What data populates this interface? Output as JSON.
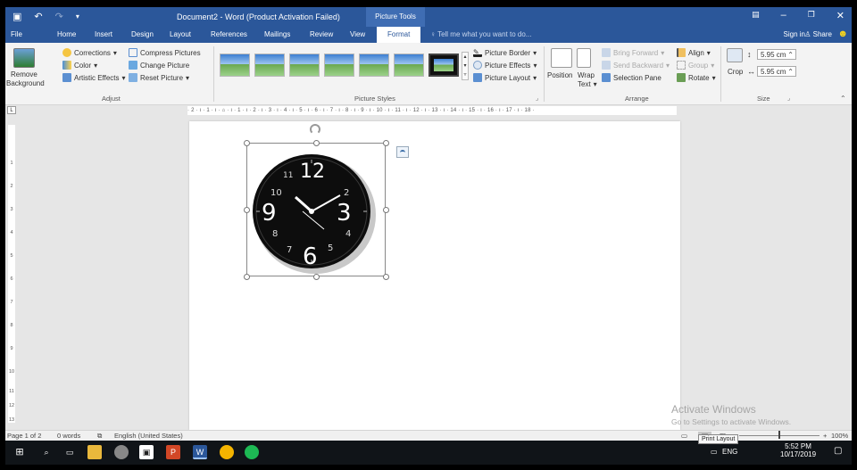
{
  "titlebar": {
    "title": "Document2 - Word (Product Activation Failed)",
    "tools_tab": "Picture Tools",
    "qat_save_icon": "save-icon",
    "qat_undo_icon": "undo-icon",
    "qat_redo_icon": "redo-icon",
    "qat_more_icon": "customize-qat-icon"
  },
  "tabs": [
    {
      "label": "File"
    },
    {
      "label": "Home"
    },
    {
      "label": "Insert"
    },
    {
      "label": "Design"
    },
    {
      "label": "Layout"
    },
    {
      "label": "References"
    },
    {
      "label": "Mailings"
    },
    {
      "label": "Review"
    },
    {
      "label": "View"
    },
    {
      "label": "Format",
      "active": true
    }
  ],
  "tell_me": "Tell me what you want to do...",
  "account": {
    "sign_in": "Sign in",
    "share": "Share"
  },
  "ribbon": {
    "adjust": {
      "label": "Adjust",
      "remove_background_1": "Remove",
      "remove_background_2": "Background",
      "corrections": "Corrections",
      "color": "Color",
      "artistic_effects": "Artistic Effects",
      "compress": "Compress Pictures",
      "change": "Change Picture",
      "reset": "Reset Picture"
    },
    "picture_styles": {
      "label": "Picture Styles",
      "border": "Picture Border",
      "effects": "Picture Effects",
      "layout": "Picture Layout"
    },
    "arrange": {
      "label": "Arrange",
      "position": "Position",
      "wrap_1": "Wrap",
      "wrap_2": "Text",
      "bring_forward": "Bring Forward",
      "send_backward": "Send Backward",
      "selection_pane": "Selection Pane",
      "align": "Align",
      "group": "Group",
      "rotate": "Rotate"
    },
    "size": {
      "label": "Size",
      "crop": "Crop",
      "height": "5.95 cm",
      "width": "5.95 cm"
    }
  },
  "ruler": {
    "horizontal": "· 2 · ı · 1 · ı · ⌂ · ı · 1 · ı · 2 · ı · 3 · ı · 4 · ı · 5 · ı · 6 · ı · 7 · ı · 8 · ı · 9 · ı · 10 · ı · 11 · ı · 12 · ı · 13 · ı · 14 · ı · 15 · ı · 16 · ı · 17 · ı · 18 ·",
    "vertical": [
      "1",
      "2",
      "3",
      "4",
      "5",
      "6",
      "7",
      "8",
      "9",
      "10",
      "11",
      "12",
      "13"
    ]
  },
  "clock": {
    "numbers": [
      "12",
      "3",
      "6",
      "9",
      "10",
      "2",
      "4",
      "5",
      "8",
      "11",
      "7"
    ]
  },
  "activate": {
    "line1": "Activate Windows",
    "line2": "Go to Settings to activate Windows."
  },
  "status": {
    "page": "Page 1 of 2",
    "words": "0 words",
    "language": "English (United States)",
    "zoom": "100%"
  },
  "taskbar": {
    "tooltip": "Print Layout",
    "lang": "ENG",
    "time": "5:52 PM",
    "date": "10/17/2019"
  },
  "colors": {
    "word_blue": "#2b579a",
    "ribbon_bg": "#f3f3f3",
    "taskbar": "#101418"
  }
}
